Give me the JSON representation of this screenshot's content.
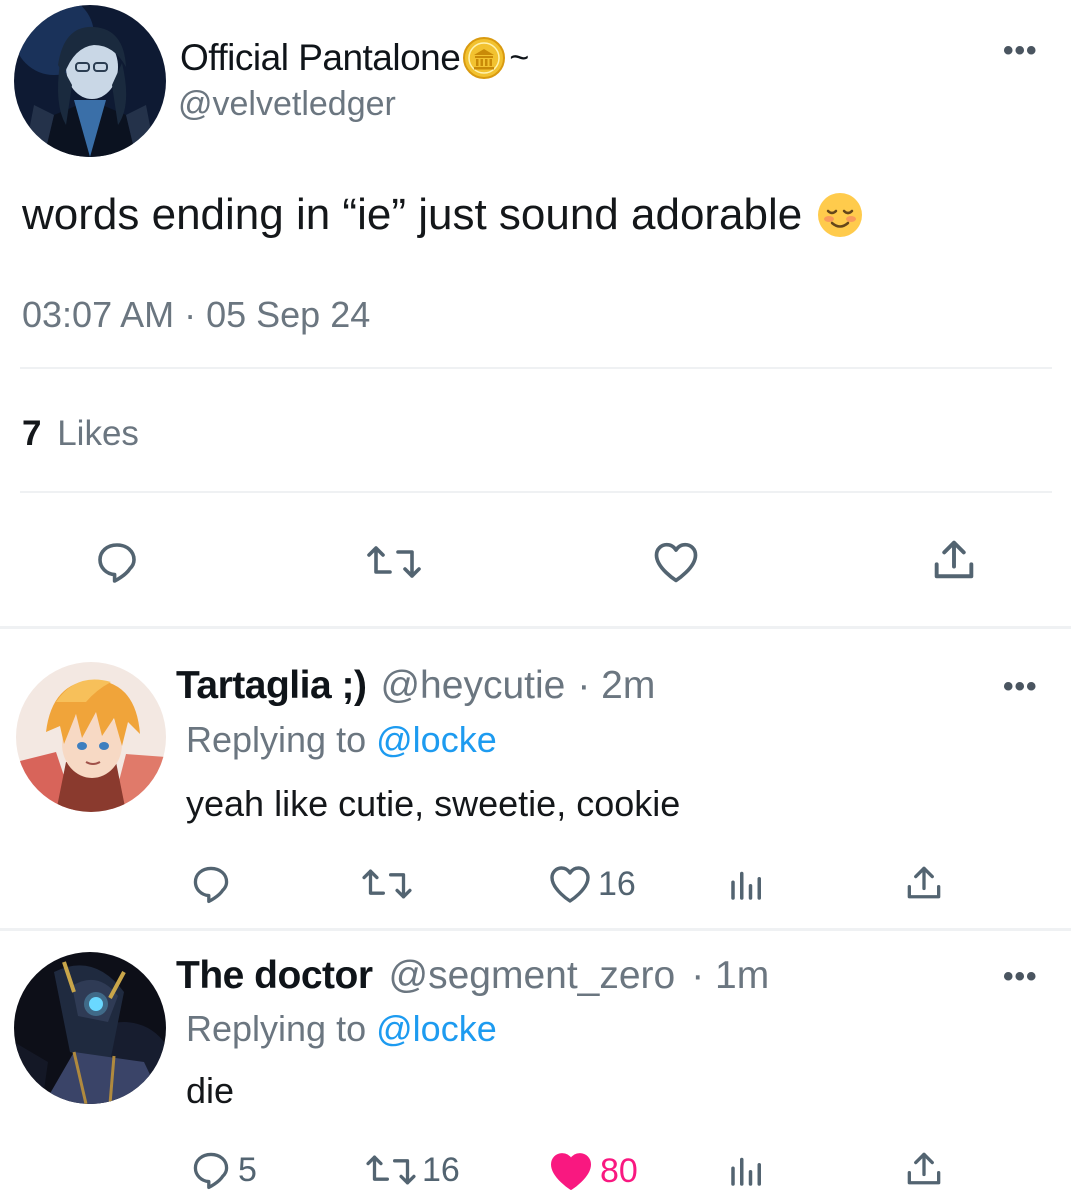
{
  "main_tweet": {
    "display_name": "Official Pantalone",
    "name_suffix": "~",
    "handle": "@velvetledger",
    "text": "words ending in “ie” just sound adorable",
    "emoji": "☺️",
    "timestamp": "03:07 AM · 05 Sep 24",
    "likes_count": "7",
    "likes_label": "Likes",
    "badge_icon": "gold-coin-icon"
  },
  "replies": [
    {
      "display_name": "Tartaglia ;)",
      "handle": "@heycutie",
      "time": "· 2m",
      "replying_prefix": "Replying to",
      "replying_handle": "@locke",
      "text": "yeah like cutie, sweetie, cookie",
      "reply_count": "",
      "retweet_count": "",
      "like_count": "16",
      "liked": false
    },
    {
      "display_name": "The doctor",
      "handle": "@segment_zero",
      "time": "· 1m",
      "replying_prefix": "Replying to",
      "replying_handle": "@locke",
      "text": "die",
      "reply_count": "5",
      "retweet_count": "16",
      "like_count": "80",
      "liked": true
    }
  ],
  "colors": {
    "link_blue": "#1d9bf0",
    "like_red": "#f91880",
    "gray_text": "#6b7680"
  }
}
